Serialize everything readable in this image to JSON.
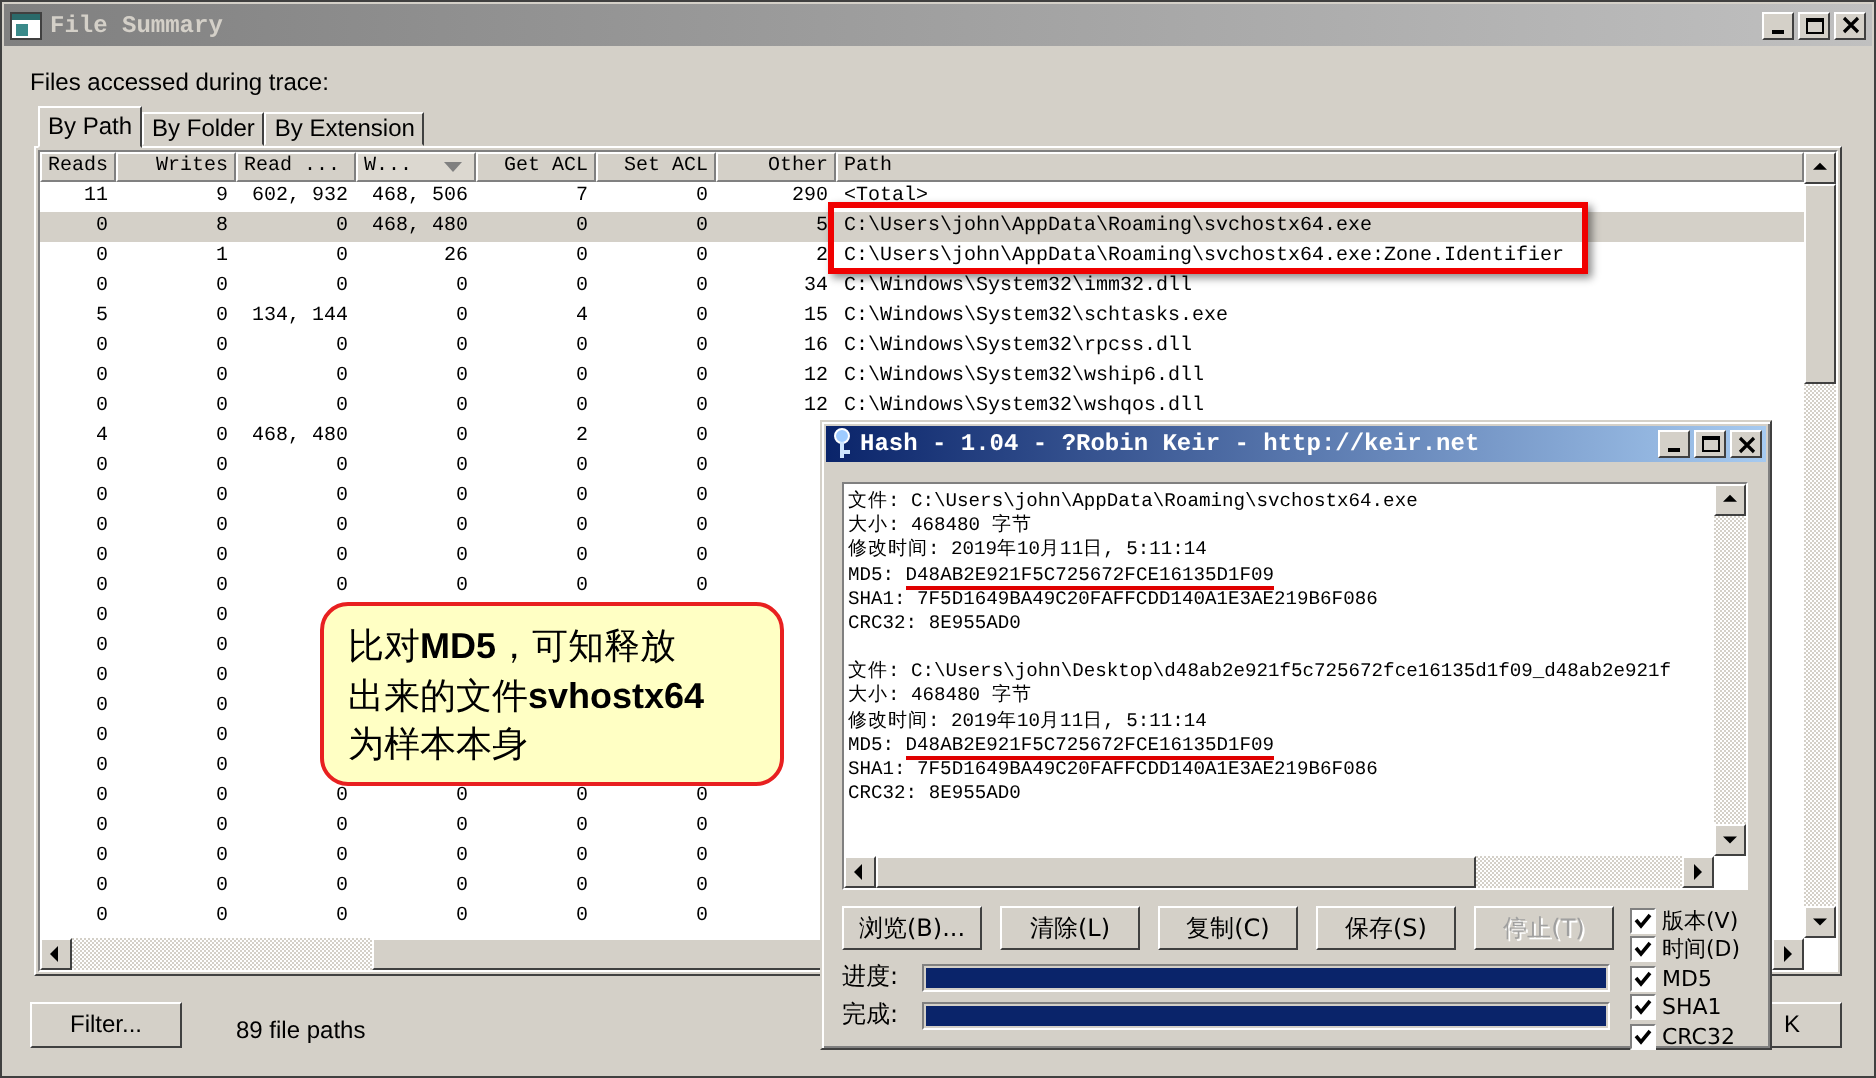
{
  "main_window": {
    "title": "File Summary",
    "label": "Files accessed during trace:",
    "tabs": [
      {
        "label": "By Path",
        "selected": true
      },
      {
        "label": "By Folder",
        "selected": false
      },
      {
        "label": "By Extension",
        "selected": false
      }
    ],
    "table": {
      "columns": [
        {
          "label": "Reads",
          "sorted": false
        },
        {
          "label": "Writes",
          "sorted": false
        },
        {
          "label": "Read ...",
          "sorted": false
        },
        {
          "label": "W...",
          "sorted": true
        },
        {
          "label": "Get ACL",
          "sorted": false
        },
        {
          "label": "Set ACL",
          "sorted": false
        },
        {
          "label": "Other",
          "sorted": false
        },
        {
          "label": "Path",
          "sorted": false
        }
      ],
      "rows": [
        {
          "selected": false,
          "cells": [
            "11",
            "9",
            "602, 932",
            "468, 506",
            "7",
            "0",
            "290",
            "<Total>"
          ]
        },
        {
          "selected": true,
          "cells": [
            "0",
            "8",
            "0",
            "468, 480",
            "0",
            "0",
            "5",
            "C:\\Users\\john\\AppData\\Roaming\\svchostx64.exe"
          ]
        },
        {
          "selected": false,
          "cells": [
            "0",
            "1",
            "0",
            "26",
            "0",
            "0",
            "2",
            "C:\\Users\\john\\AppData\\Roaming\\svchostx64.exe:Zone.Identifier"
          ]
        },
        {
          "selected": false,
          "cells": [
            "0",
            "0",
            "0",
            "0",
            "0",
            "0",
            "34",
            "C:\\Windows\\System32\\imm32.dll"
          ]
        },
        {
          "selected": false,
          "cells": [
            "5",
            "0",
            "134, 144",
            "0",
            "4",
            "0",
            "15",
            "C:\\Windows\\System32\\schtasks.exe"
          ]
        },
        {
          "selected": false,
          "cells": [
            "0",
            "0",
            "0",
            "0",
            "0",
            "0",
            "16",
            "C:\\Windows\\System32\\rpcss.dll"
          ]
        },
        {
          "selected": false,
          "cells": [
            "0",
            "0",
            "0",
            "0",
            "0",
            "0",
            "12",
            "C:\\Windows\\System32\\wship6.dll"
          ]
        },
        {
          "selected": false,
          "cells": [
            "0",
            "0",
            "0",
            "0",
            "0",
            "0",
            "12",
            "C:\\Windows\\System32\\wshqos.dll"
          ]
        },
        {
          "selected": false,
          "cells": [
            "4",
            "0",
            "468, 480",
            "0",
            "2",
            "0"
          ]
        },
        {
          "selected": false,
          "cells": [
            "0",
            "0",
            "0",
            "0",
            "0",
            "0"
          ]
        },
        {
          "selected": false,
          "cells": [
            "0",
            "0",
            "0",
            "0",
            "0",
            "0"
          ]
        },
        {
          "selected": false,
          "cells": [
            "0",
            "0",
            "0",
            "0",
            "0",
            "0"
          ]
        },
        {
          "selected": false,
          "cells": [
            "0",
            "0",
            "0",
            "0",
            "0",
            "0"
          ]
        },
        {
          "selected": false,
          "cells": [
            "0",
            "0",
            "0",
            "0",
            "0",
            "0"
          ]
        },
        {
          "selected": false,
          "cells": [
            "0",
            "0"
          ]
        },
        {
          "selected": false,
          "cells": [
            "0",
            "0"
          ]
        },
        {
          "selected": false,
          "cells": [
            "0",
            "0"
          ]
        },
        {
          "selected": false,
          "cells": [
            "0",
            "0"
          ]
        },
        {
          "selected": false,
          "cells": [
            "0",
            "0"
          ]
        },
        {
          "selected": false,
          "cells": [
            "0",
            "0"
          ]
        },
        {
          "selected": false,
          "cells": [
            "0",
            "0",
            "0",
            "0",
            "0",
            "0"
          ]
        },
        {
          "selected": false,
          "cells": [
            "0",
            "0",
            "0",
            "0",
            "0",
            "0"
          ]
        },
        {
          "selected": false,
          "cells": [
            "0",
            "0",
            "0",
            "0",
            "0",
            "0"
          ]
        },
        {
          "selected": false,
          "cells": [
            "0",
            "0",
            "0",
            "0",
            "0",
            "0"
          ]
        },
        {
          "selected": false,
          "cells": [
            "0",
            "0",
            "0",
            "0",
            "0",
            "0"
          ]
        }
      ]
    },
    "filter_button": "Filter...",
    "status": "89 file paths",
    "ok_button": "K"
  },
  "hash_window": {
    "title": "Hash - 1.04 - ?Robin Keir - http://keir.net",
    "blocks": [
      {
        "lines": [
          {
            "label": "文件:",
            "value": "C:\\Users\\john\\AppData\\Roaming\\svchostx64.exe",
            "marked": false
          },
          {
            "label": "大小:",
            "value": "468480 字节",
            "marked": false
          },
          {
            "label": "修改时间:",
            "value": "2019年10月11日, 5:11:14",
            "marked": false
          },
          {
            "label": "MD5:",
            "value": "D48AB2E921F5C725672FCE16135D1F09",
            "marked": true
          },
          {
            "label": "SHA1:",
            "value": "7F5D1649BA49C20FAFFCDD140A1E3AE219B6F086",
            "marked": false
          },
          {
            "label": "CRC32:",
            "value": "8E955AD0",
            "marked": false
          }
        ]
      },
      {
        "lines": [
          {
            "label": "文件:",
            "value": "C:\\Users\\john\\Desktop\\d48ab2e921f5c725672fce16135d1f09_d48ab2e921f",
            "marked": false
          },
          {
            "label": "大小:",
            "value": "468480 字节",
            "marked": false
          },
          {
            "label": "修改时间:",
            "value": "2019年10月11日, 5:11:14",
            "marked": false
          },
          {
            "label": "MD5:",
            "value": "D48AB2E921F5C725672FCE16135D1F09",
            "marked": true
          },
          {
            "label": "SHA1:",
            "value": "7F5D1649BA49C20FAFFCDD140A1E3AE219B6F086",
            "marked": false
          },
          {
            "label": "CRC32:",
            "value": "8E955AD0",
            "marked": false
          }
        ]
      }
    ],
    "buttons": [
      {
        "label": "浏览(B)...",
        "disabled": false
      },
      {
        "label": "清除(L)",
        "disabled": false
      },
      {
        "label": "复制(C)",
        "disabled": false
      },
      {
        "label": "保存(S)",
        "disabled": false
      },
      {
        "label": "停止(T)",
        "disabled": true
      }
    ],
    "progress": [
      {
        "label": "进度:",
        "level": 1
      },
      {
        "label": "完成:",
        "level": 1
      }
    ],
    "checkboxes": [
      {
        "label": "版本(V)",
        "checked": true
      },
      {
        "label": "时间(D)",
        "checked": true
      },
      {
        "label": "MD5",
        "checked": true
      },
      {
        "label": "SHA1",
        "checked": true
      },
      {
        "label": "CRC32",
        "checked": true
      }
    ]
  },
  "callout": {
    "lines": [
      "比对**MD5**，可知释放",
      "出来的文件**svhostx64**",
      "为样本本身"
    ]
  }
}
